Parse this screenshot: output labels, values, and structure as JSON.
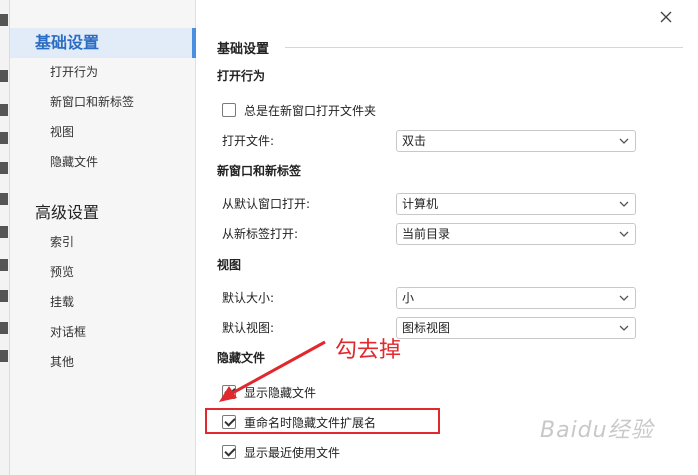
{
  "sidebar": {
    "groups": [
      {
        "label": "基础设置",
        "items": [
          "打开行为",
          "新窗口和新标签",
          "视图",
          "隐藏文件"
        ]
      },
      {
        "label": "高级设置",
        "items": [
          "索引",
          "预览",
          "挂载",
          "对话框",
          "其他"
        ]
      }
    ]
  },
  "main": {
    "section_title": "基础设置",
    "open_behavior": {
      "title": "打开行为",
      "always_new_window": "总是在新窗口打开文件夹",
      "open_file_label": "打开文件:",
      "open_file_value": "双击"
    },
    "new_window": {
      "title": "新窗口和新标签",
      "default_window_label": "从默认窗口打开:",
      "default_window_value": "计算机",
      "new_tab_label": "从新标签打开:",
      "new_tab_value": "当前目录"
    },
    "view": {
      "title": "视图",
      "default_size_label": "默认大小:",
      "default_size_value": "小",
      "default_view_label": "默认视图:",
      "default_view_value": "图标视图"
    },
    "hidden": {
      "title": "隐藏文件",
      "show_hidden": "显示隐藏文件",
      "hide_ext_on_rename": "重命名时隐藏文件扩展名",
      "show_recent": "显示最近使用文件"
    }
  },
  "annotation": {
    "text": "勾去掉",
    "color": "#e0282d"
  },
  "watermark": "Baidu经验",
  "colors": {
    "accent": "#2b6cc4",
    "active_bg": "#e1ecf8",
    "annotation": "#e0282d"
  }
}
